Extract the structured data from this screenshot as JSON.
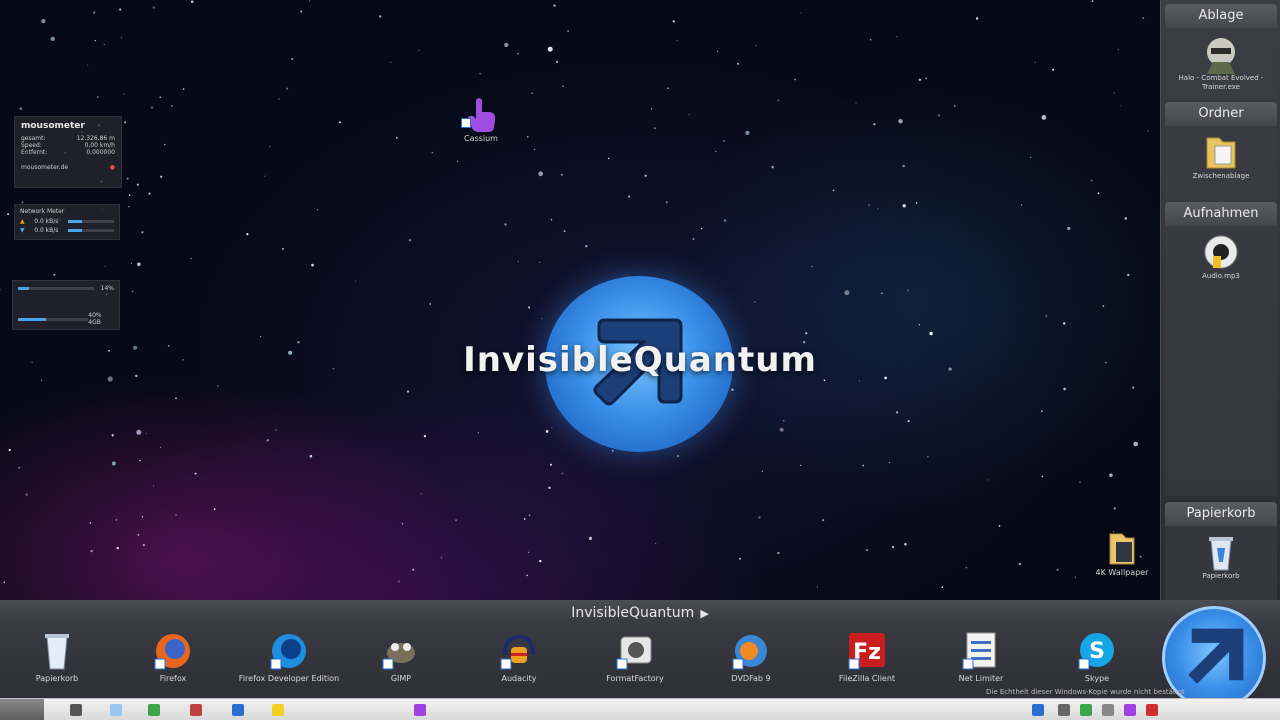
{
  "desktop": {
    "top_icon": {
      "label": "Cassium"
    },
    "logo_text": "InvisibleQuantum",
    "wallpaper_folder": {
      "label": "4K Wallpaper"
    }
  },
  "widgets": {
    "mousometer": {
      "title": "mousometer",
      "rows": [
        {
          "k": "gesamt:",
          "v": "12.326,86 m"
        },
        {
          "k": "Speed:",
          "v": "0,00 km/h"
        },
        {
          "k": "Entfernt:",
          "v": "0,000000"
        }
      ],
      "footer": "mousometer.de"
    },
    "network": {
      "title": "Network Meter",
      "rows": [
        {
          "v": "0.0 kB/s",
          "fill": 0.3
        },
        {
          "v": "0.0 kB/s",
          "fill": 0.3
        }
      ]
    },
    "system": {
      "rows": [
        {
          "v": "14%",
          "fill": 0.14
        },
        {
          "v": "40% 4GB",
          "fill": 0.4
        }
      ]
    }
  },
  "side_panel": {
    "sections": [
      {
        "title": "Ablage",
        "items": [
          {
            "label": "Halo - Combat Evolved - Trainer.exe",
            "icon": "soldier-icon"
          }
        ]
      },
      {
        "title": "Ordner",
        "items": [
          {
            "label": "Zwischenablage",
            "icon": "folder-icon"
          }
        ]
      },
      {
        "title": "Aufnahmen",
        "items": [
          {
            "label": "Audio.mp3",
            "icon": "audio-file-icon"
          }
        ]
      },
      {
        "title": "Papierkorb",
        "items": [
          {
            "label": "Papierkorb",
            "icon": "recycle-bin-icon"
          }
        ]
      }
    ]
  },
  "dock": {
    "title": "InvisibleQuantum",
    "title_arrow": "▶",
    "items": [
      {
        "label": "Papierkorb",
        "icon": "recycle-bin-icon"
      },
      {
        "label": "Firefox",
        "icon": "firefox-icon"
      },
      {
        "label": "Firefox Developer Edition",
        "icon": "firefox-dev-icon"
      },
      {
        "label": "GIMP",
        "icon": "gimp-icon"
      },
      {
        "label": "Audacity",
        "icon": "audacity-icon"
      },
      {
        "label": "FormatFactory",
        "icon": "formatfactory-icon"
      },
      {
        "label": "DVDFab 9",
        "icon": "dvdfab-icon"
      },
      {
        "label": "FileZilla Client",
        "icon": "filezilla-icon"
      },
      {
        "label": "Net Limiter",
        "icon": "netlimiter-icon"
      },
      {
        "label": "Skype",
        "icon": "skype-icon"
      }
    ],
    "activation_text": "Die Echtheit dieser Windows-Kopie wurde nicht bestätigt"
  },
  "colors": {
    "accent_blue": "#3a8fe8",
    "dock_bg": "#3a3b42",
    "taskbar_bg": "#e4e4e4"
  }
}
